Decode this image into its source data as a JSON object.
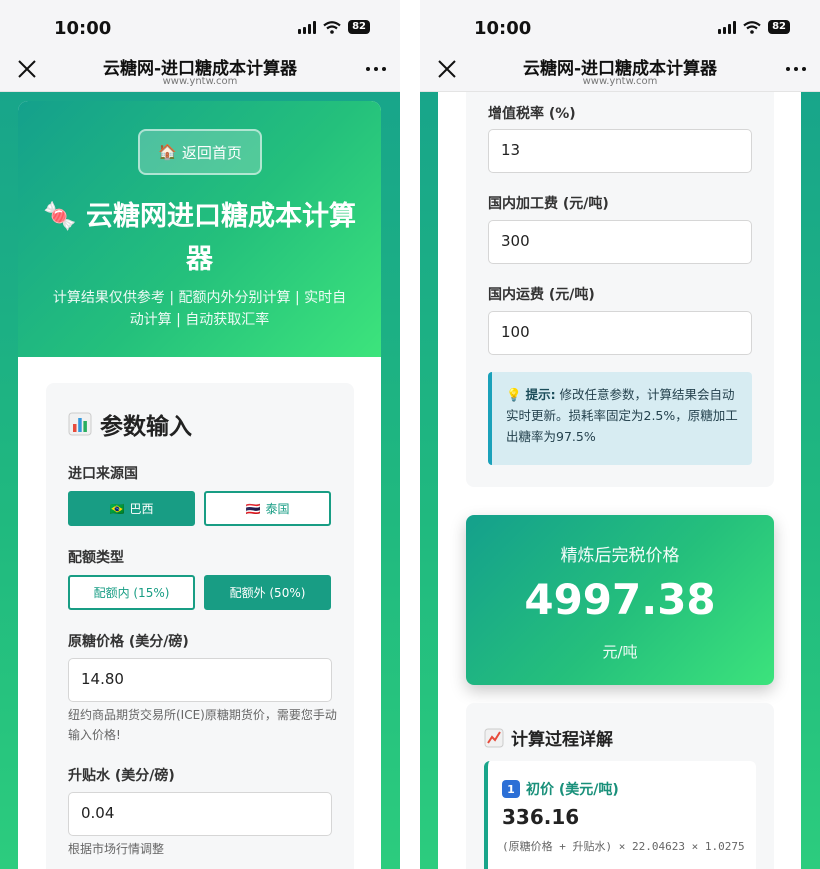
{
  "status": {
    "time": "10:00",
    "battery": "82"
  },
  "navbar": {
    "title": "云糖网-进口糖成本计算器",
    "url": "www.yntw.com"
  },
  "hero": {
    "home_button": "返回首页",
    "title": "云糖网进口糖成本计算器",
    "subtitle": "计算结果仅供参考 | 配额内外分别计算 | 实时自动计算 | 自动获取汇率"
  },
  "params": {
    "title": "参数输入",
    "origin_label": "进口来源国",
    "origins": [
      {
        "label": "巴西",
        "flag": "🇧🇷",
        "selected": true
      },
      {
        "label": "泰国",
        "flag": "🇹🇭",
        "selected": false
      }
    ],
    "quota_label": "配额类型",
    "quotas": [
      {
        "label": "配额内 (15%)",
        "selected": false
      },
      {
        "label": "配额外 (50%)",
        "selected": true
      }
    ],
    "raw_price_label": "原糖价格 (美分/磅)",
    "raw_price_value": "14.80",
    "raw_price_hint": "纽约商品期货交易所(ICE)原糖期货价，需要您手动输入价格!",
    "premium_label": "升贴水 (美分/磅)",
    "premium_value": "0.04",
    "premium_hint": "根据市场行情调整",
    "vat_label": "增值税率 (%)",
    "vat_value": "13",
    "processing_label": "国内加工费 (元/吨)",
    "processing_value": "300",
    "freight_label": "国内运费 (元/吨)",
    "freight_value": "100",
    "tip_title": "提示:",
    "tip_text": "修改任意参数，计算结果会自动实时更新。损耗率固定为2.5%，原糖加工出糖率为97.5%"
  },
  "result": {
    "label": "精炼后完税价格",
    "value": "4997.38",
    "unit": "元/吨"
  },
  "process": {
    "title": "计算过程详解",
    "steps": [
      {
        "number": "1",
        "title": "初价 (美元/吨)",
        "value": "336.16",
        "formula": "(原糖价格 + 升贴水) × 22.04623 × 1.0275"
      }
    ]
  },
  "colors": {
    "accent": "#189d84",
    "accent_light": "#3de47c",
    "tip_bg": "#d7ecf2"
  }
}
